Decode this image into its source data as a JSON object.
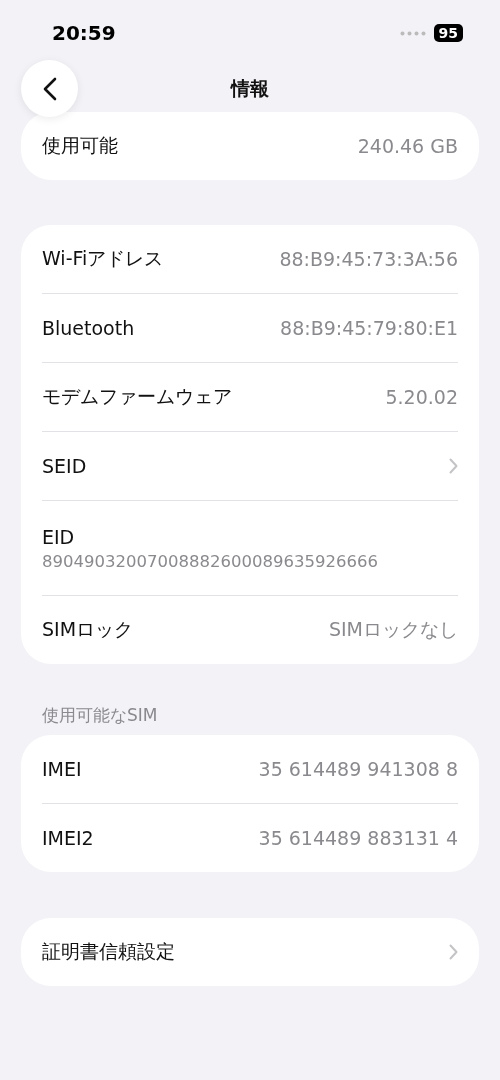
{
  "status_bar": {
    "time": "20:59",
    "battery": "95"
  },
  "nav": {
    "title": "情報"
  },
  "groups": [
    {
      "rows": [
        {
          "kind": "value",
          "label": "使用可能",
          "value": "240.46 GB"
        }
      ]
    },
    {
      "rows": [
        {
          "kind": "value",
          "label": "Wi-Fiアドレス",
          "value": "88:B9:45:73:3A:56"
        },
        {
          "kind": "value",
          "label": "Bluetooth",
          "value": "88:B9:45:79:80:E1"
        },
        {
          "kind": "value",
          "label": "モデムファームウェア",
          "value": "5.20.02"
        },
        {
          "kind": "link",
          "label": "SEID"
        },
        {
          "kind": "stacked",
          "label": "EID",
          "value": "89049032007008882600089635926666"
        },
        {
          "kind": "value",
          "label": "SIMロック",
          "value": "SIMロックなし"
        }
      ]
    },
    {
      "header": "使用可能なSIM",
      "rows": [
        {
          "kind": "value",
          "label": "IMEI",
          "value": "35 614489 941308 8"
        },
        {
          "kind": "value",
          "label": "IMEI2",
          "value": "35 614489 883131 4"
        }
      ]
    },
    {
      "rows": [
        {
          "kind": "link",
          "label": "証明書信頼設定"
        }
      ]
    }
  ]
}
